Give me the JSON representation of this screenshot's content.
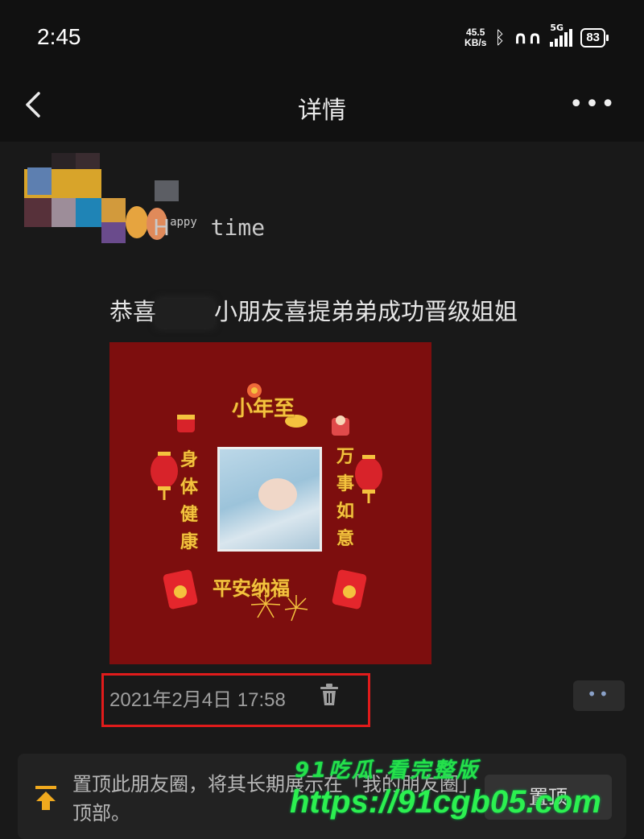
{
  "status_bar": {
    "time": "2:45",
    "net_speed_value": "45.5",
    "net_speed_unit": "KB/s",
    "network": "5G",
    "battery": "83",
    "icons": [
      "bluetooth-icon",
      "earbuds-icon",
      "signal-icon",
      "battery-icon"
    ]
  },
  "nav": {
    "title": "详情",
    "more": "•••",
    "back_icon": "chevron-left-icon"
  },
  "post": {
    "username_cap": "H",
    "username_sup": "appy",
    "username_rest": " time",
    "text_prefix": "恭喜",
    "text_suffix": "小朋友喜提弟弟成功晋级姐姐",
    "image": {
      "top": "小年至",
      "left": [
        "身",
        "体",
        "健",
        "康"
      ],
      "right": [
        "万",
        "事",
        "如",
        "意"
      ],
      "bottom": "平安纳福",
      "colors": {
        "background": "#7d0e0e",
        "text": "#f4c23e"
      }
    },
    "timestamp": "2021年2月4日 17:58",
    "more_small": "••"
  },
  "pin": {
    "text": "置顶此朋友圈，将其长期展示在「我的朋友圈」顶部。",
    "button": "置顶"
  },
  "watermark": {
    "line1": "91吃瓜-看完整版",
    "line2": "https://91cgb05.com",
    "color": "#2cf050"
  },
  "highlight_color": "#e01b1b"
}
